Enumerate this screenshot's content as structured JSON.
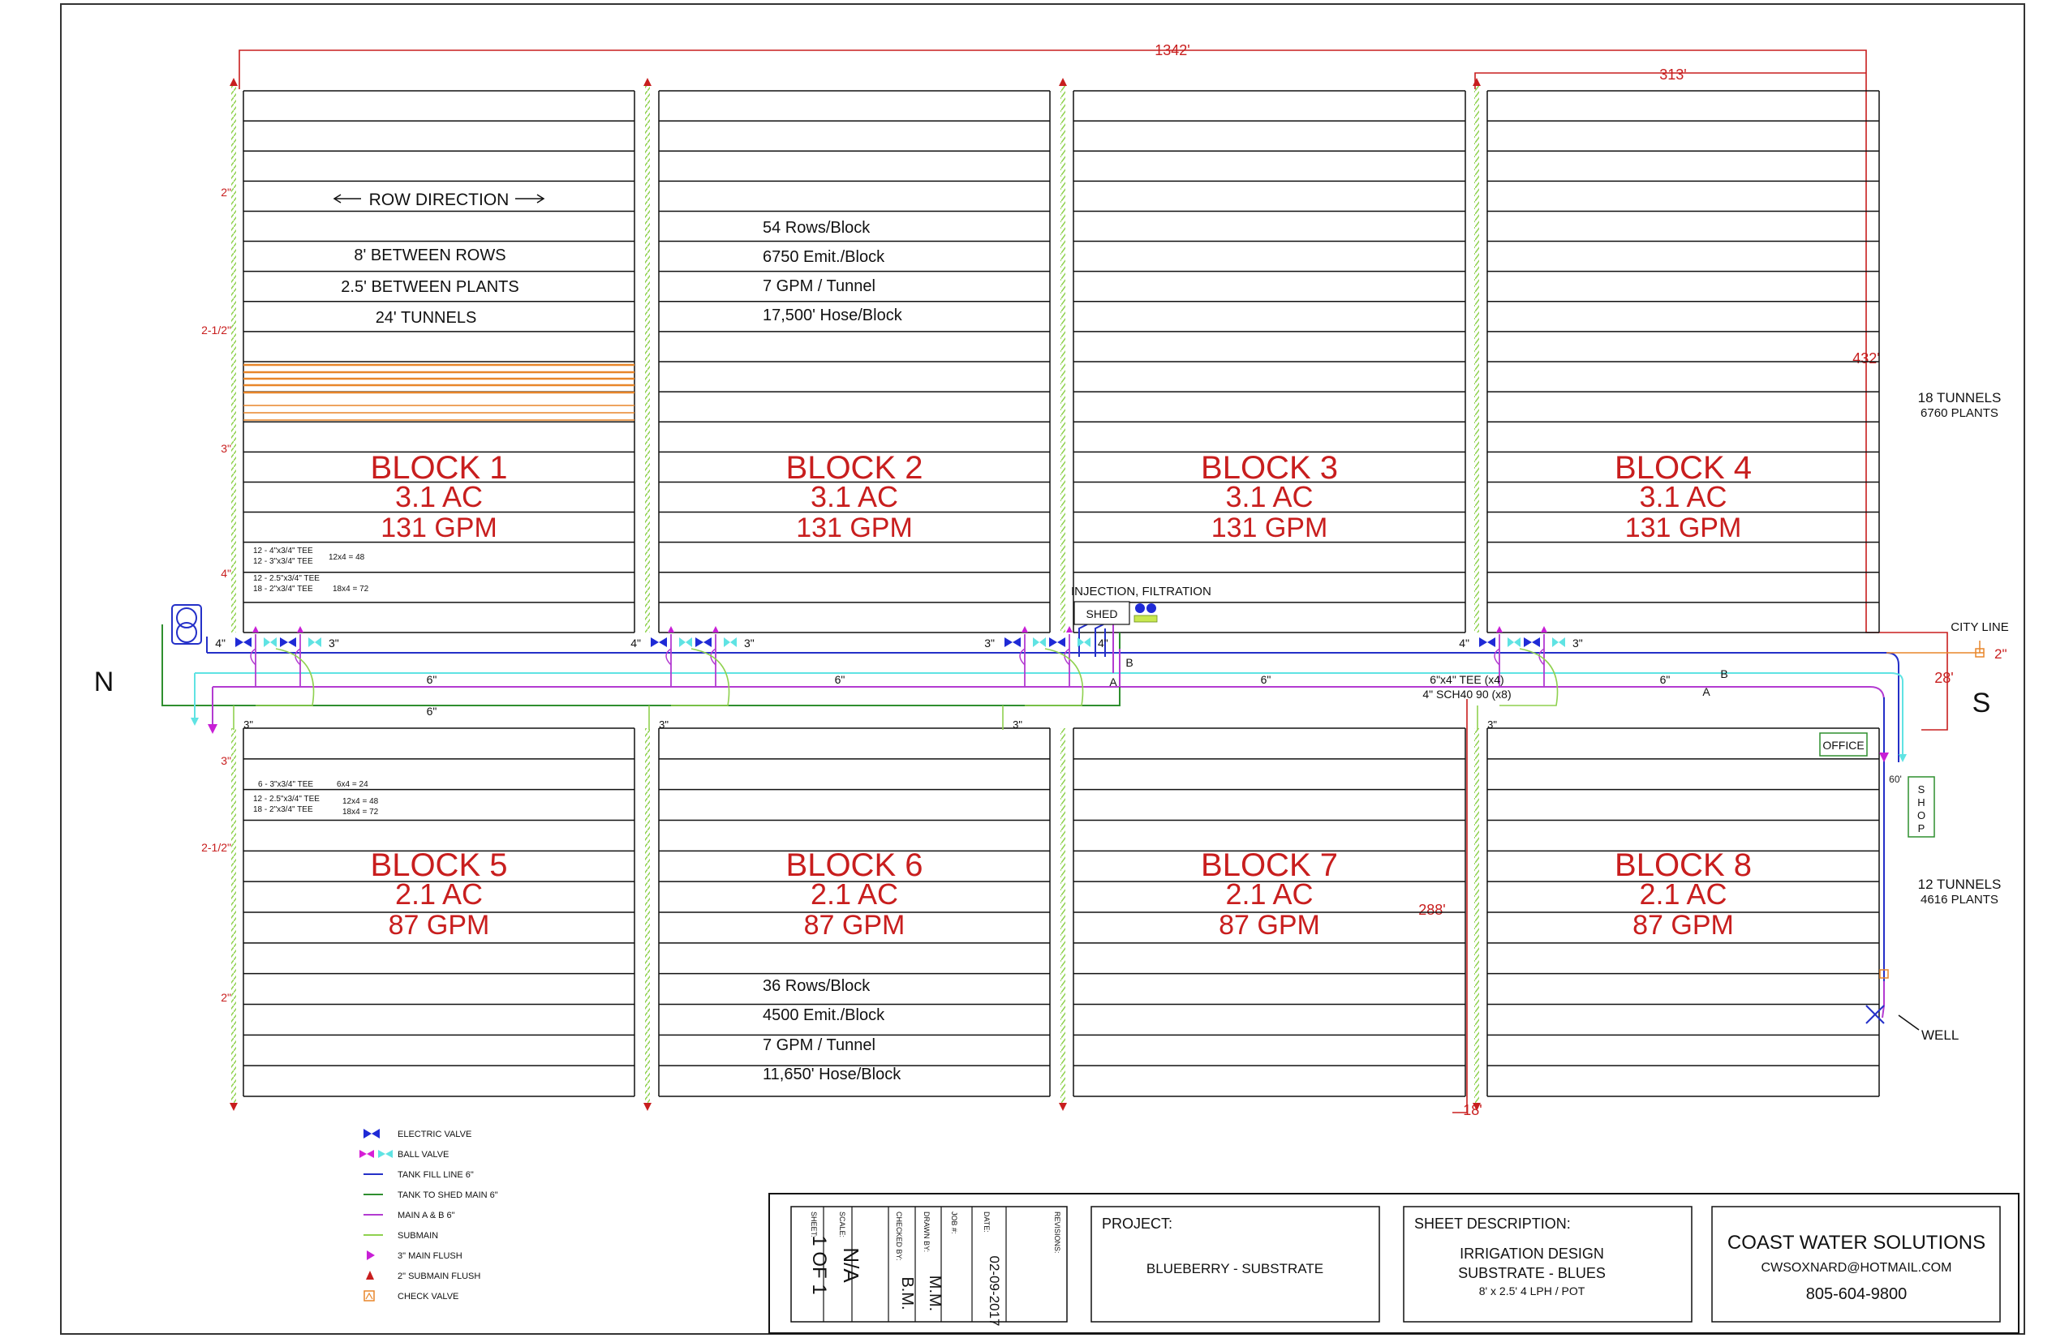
{
  "dimensions": {
    "overall_width": "1342'",
    "top_row": "313'",
    "right_vertical": "432'",
    "south_gap": "28'",
    "block7_height": "288'",
    "bottom_gap": "18'",
    "shop_offset": "60'"
  },
  "compass": {
    "north": "N",
    "south": "S"
  },
  "block1_notes": [
    "ROW DIRECTION",
    "8' BETWEEN ROWS",
    "2.5' BETWEEN PLANTS",
    "24'  TUNNELS"
  ],
  "top_block_stats": [
    "54 Rows/Block",
    "6750 Emit./Block",
    "7 GPM / Tunnel",
    "17,500' Hose/Block"
  ],
  "bottom_block_stats": [
    "36 Rows/Block",
    "4500 Emit./Block",
    "7 GPM / Tunnel",
    "11,650' Hose/Block"
  ],
  "top_blocks": [
    {
      "name": "BLOCK 1",
      "area": "3.1 AC",
      "flow": "131 GPM"
    },
    {
      "name": "BLOCK 2",
      "area": "3.1 AC",
      "flow": "131 GPM"
    },
    {
      "name": "BLOCK 3",
      "area": "3.1 AC",
      "flow": "131 GPM"
    },
    {
      "name": "BLOCK 4",
      "area": "3.1 AC",
      "flow": "131 GPM"
    }
  ],
  "bottom_blocks": [
    {
      "name": "BLOCK 5",
      "area": "2.1 AC",
      "flow": "87 GPM"
    },
    {
      "name": "BLOCK 6",
      "area": "2.1 AC",
      "flow": "87 GPM"
    },
    {
      "name": "BLOCK 7",
      "area": "2.1 AC",
      "flow": "87 GPM"
    },
    {
      "name": "BLOCK 8",
      "area": "2.1 AC",
      "flow": "87 GPM"
    }
  ],
  "top_tunnels": {
    "count": "18 TUNNELS",
    "plants": "6760 PLANTS"
  },
  "bottom_tunnels": {
    "count": "12 TUNNELS",
    "plants": "4616 PLANTS"
  },
  "submain_sizes_top": [
    "2\"",
    "2-1/2\"",
    "3\"",
    "4\""
  ],
  "submain_sizes_bottom": [
    "3\"",
    "2-1/2\"",
    "2\""
  ],
  "valve_labels": {
    "four_inch": "4\"",
    "three_inch": "3\"",
    "main_6": "6\"",
    "tee": "6\"x4\" TEE (x4)",
    "elbow": "4\" SCH40 90 (x8)",
    "a": "A",
    "b": "B",
    "two_inch": "2\""
  },
  "tee_notes_top": [
    {
      "text": "12 - 4\"x3/4\" TEE",
      "calc": "12x4 = 48"
    },
    {
      "text": "12 - 3\"x3/4\" TEE",
      "calc": ""
    },
    {
      "text": "12 - 2.5\"x3/4\" TEE",
      "calc": ""
    },
    {
      "text": "18 - 2\"x3/4\" TEE",
      "calc": "18x4 = 72"
    }
  ],
  "tee_notes_bottom": [
    {
      "text": "6 - 3\"x3/4\" TEE",
      "calc": "6x4 = 24"
    },
    {
      "text": "12 - 2.5\"x3/4\" TEE",
      "calc": "12x4 = 48"
    },
    {
      "text": "18 - 2\"x3/4\" TEE",
      "calc": "18x4 = 72"
    }
  ],
  "structures": {
    "injection": "INJECTION, FILTRATION",
    "shed": "SHED",
    "office": "OFFICE",
    "shop": "SHOP",
    "well": "WELL",
    "city_line": "CITY LINE"
  },
  "legend": [
    {
      "label": "ELECTRIC VALVE",
      "kind": "electric-valve",
      "color": "#1f2ad6"
    },
    {
      "label": "BALL VALVE",
      "kind": "ball-valve",
      "color": "#d61fd6"
    },
    {
      "label": "TANK FILL LINE 6\"",
      "kind": "line",
      "color": "#2430c8"
    },
    {
      "label": "TANK TO SHED MAIN 6\"",
      "kind": "line",
      "color": "#2f8f2f"
    },
    {
      "label": "MAIN A & B 6\"",
      "kind": "line",
      "color": "#b33bd1"
    },
    {
      "label": "SUBMAIN",
      "kind": "line",
      "color": "#8fd14f"
    },
    {
      "label": "3\" MAIN FLUSH",
      "kind": "flush-main",
      "color": "#c81fd6"
    },
    {
      "label": "2\" SUBMAIN FLUSH",
      "kind": "flush-sub",
      "color": "#c81e1e"
    },
    {
      "label": "CHECK VALVE",
      "kind": "check-valve",
      "color": "#e8862a"
    }
  ],
  "title_block": {
    "sheet_label": "SHEET:",
    "sheet_value": "1 OF 1",
    "scale_label": "SCALE:",
    "scale_value": "N/A",
    "checked_label": "CHECKED BY:",
    "checked_value": "B.M.",
    "drawn_label": "DRAWN BY:",
    "drawn_value": "M.M.",
    "job_label": "JOB #:",
    "job_value": "",
    "date_label": "DATE:",
    "date_value": "02-09-2017",
    "revisions_label": "REVISIONS:",
    "project_label": "PROJECT:",
    "project_value": "BLUEBERRY - SUBSTRATE",
    "sheet_desc_label": "SHEET DESCRIPTION:",
    "sheet_desc_lines": [
      "IRRIGATION DESIGN",
      "SUBSTRATE - BLUES",
      "8' x 2.5'    4 LPH / POT"
    ],
    "company": "COAST WATER SOLUTIONS",
    "email": "CWSOXNARD@HOTMAIL.COM",
    "phone": "805-604-9800"
  },
  "colors": {
    "block_label": "#c81e1e",
    "dimension": "#c81e1e",
    "tank_fill": "#2430c8",
    "tank_to_shed": "#2f8f2f",
    "main_ab": "#b33bd1",
    "submain": "#8fd14f",
    "cyan_main": "#5fe3e3",
    "orange_rows": "#e8862a"
  }
}
